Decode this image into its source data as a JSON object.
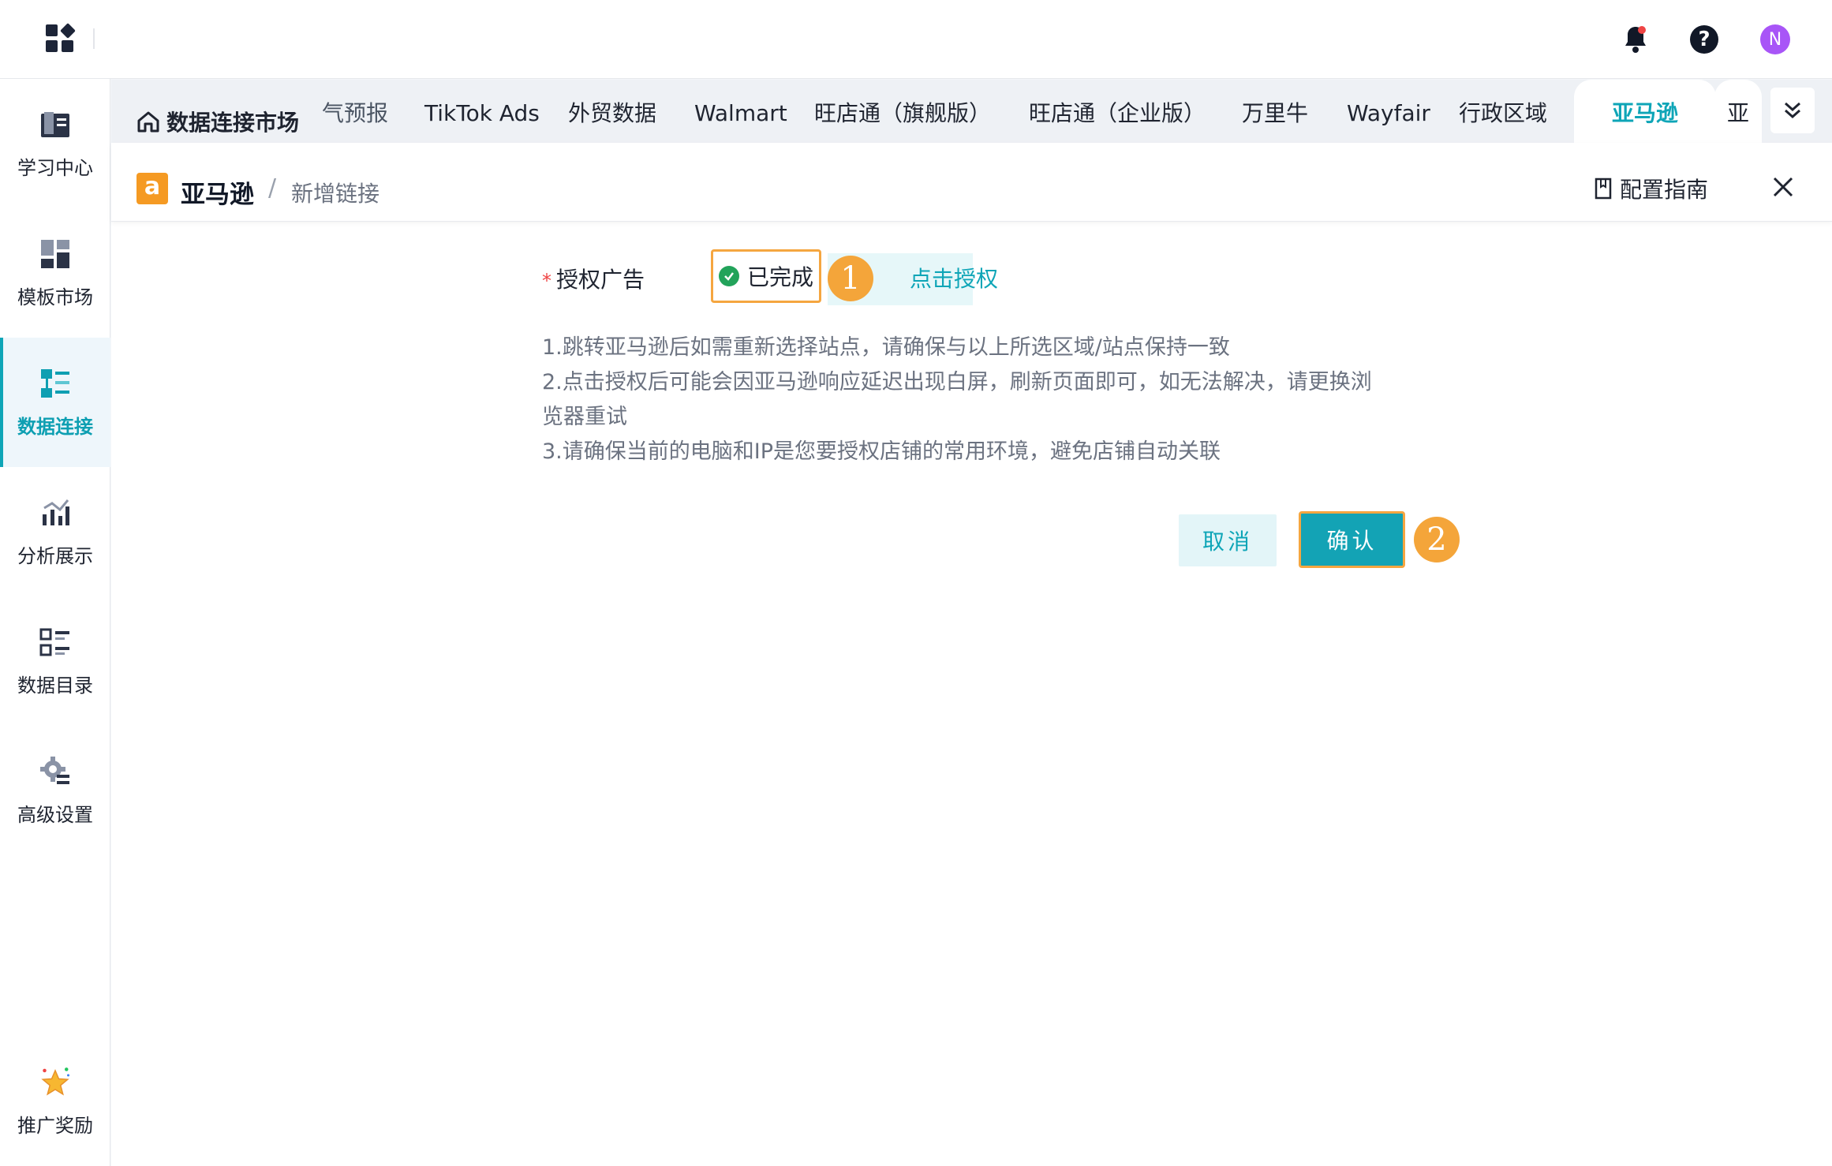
{
  "topbar": {
    "avatar_letter": "N",
    "icons": [
      "apps-grid-icon",
      "bell-icon",
      "help-icon",
      "avatar"
    ],
    "bell_dot_color": "#ef4444",
    "avatar_color": "#a855f7"
  },
  "sidebar": {
    "items": [
      {
        "label": "学习中心",
        "icon": "book-icon"
      },
      {
        "label": "模板市场",
        "icon": "template-icon"
      },
      {
        "label": "数据连接",
        "icon": "data-connect-icon",
        "active": true
      },
      {
        "label": "分析展示",
        "icon": "chart-icon"
      },
      {
        "label": "数据目录",
        "icon": "catalog-icon"
      },
      {
        "label": "高级设置",
        "icon": "gear-icon"
      }
    ],
    "bottom": {
      "label": "推广奖励",
      "icon": "star-reward-icon"
    }
  },
  "tabs": {
    "home": "数据连接市场",
    "items": [
      "气预报",
      "TikTok Ads",
      "外贸数据",
      "Walmart",
      "旺店通（旗舰版）",
      "旺店通（企业版）",
      "万里牛",
      "Wayfair",
      "行政区域",
      "亚马逊",
      "亚"
    ],
    "active": "亚马逊"
  },
  "panel": {
    "breadcrumb_main": "亚马逊",
    "breadcrumb_sep": "/",
    "breadcrumb_sub": "新增链接",
    "logo_letter": "a",
    "guide_label": "配置指南",
    "form": {
      "required_mark": "*",
      "label": "授权广告",
      "status": "已完成",
      "auth_link": "点击授权",
      "notes": [
        "1.跳转亚马逊后如需重新选择站点，请确保与以上所选区域/站点保持一致",
        "2.点击授权后可能会因亚马逊响应延迟出现白屏，刷新页面即可，如无法解决，请更换浏",
        "览器重试",
        "3.请确保当前的电脑和IP是您要授权店铺的常用环境，避免店铺自动关联"
      ]
    },
    "buttons": {
      "cancel": "取消",
      "confirm": "确认"
    },
    "step_badges": [
      "1",
      "2"
    ],
    "accent_color": "#0ea5b7",
    "highlight_color": "#f5a640"
  }
}
